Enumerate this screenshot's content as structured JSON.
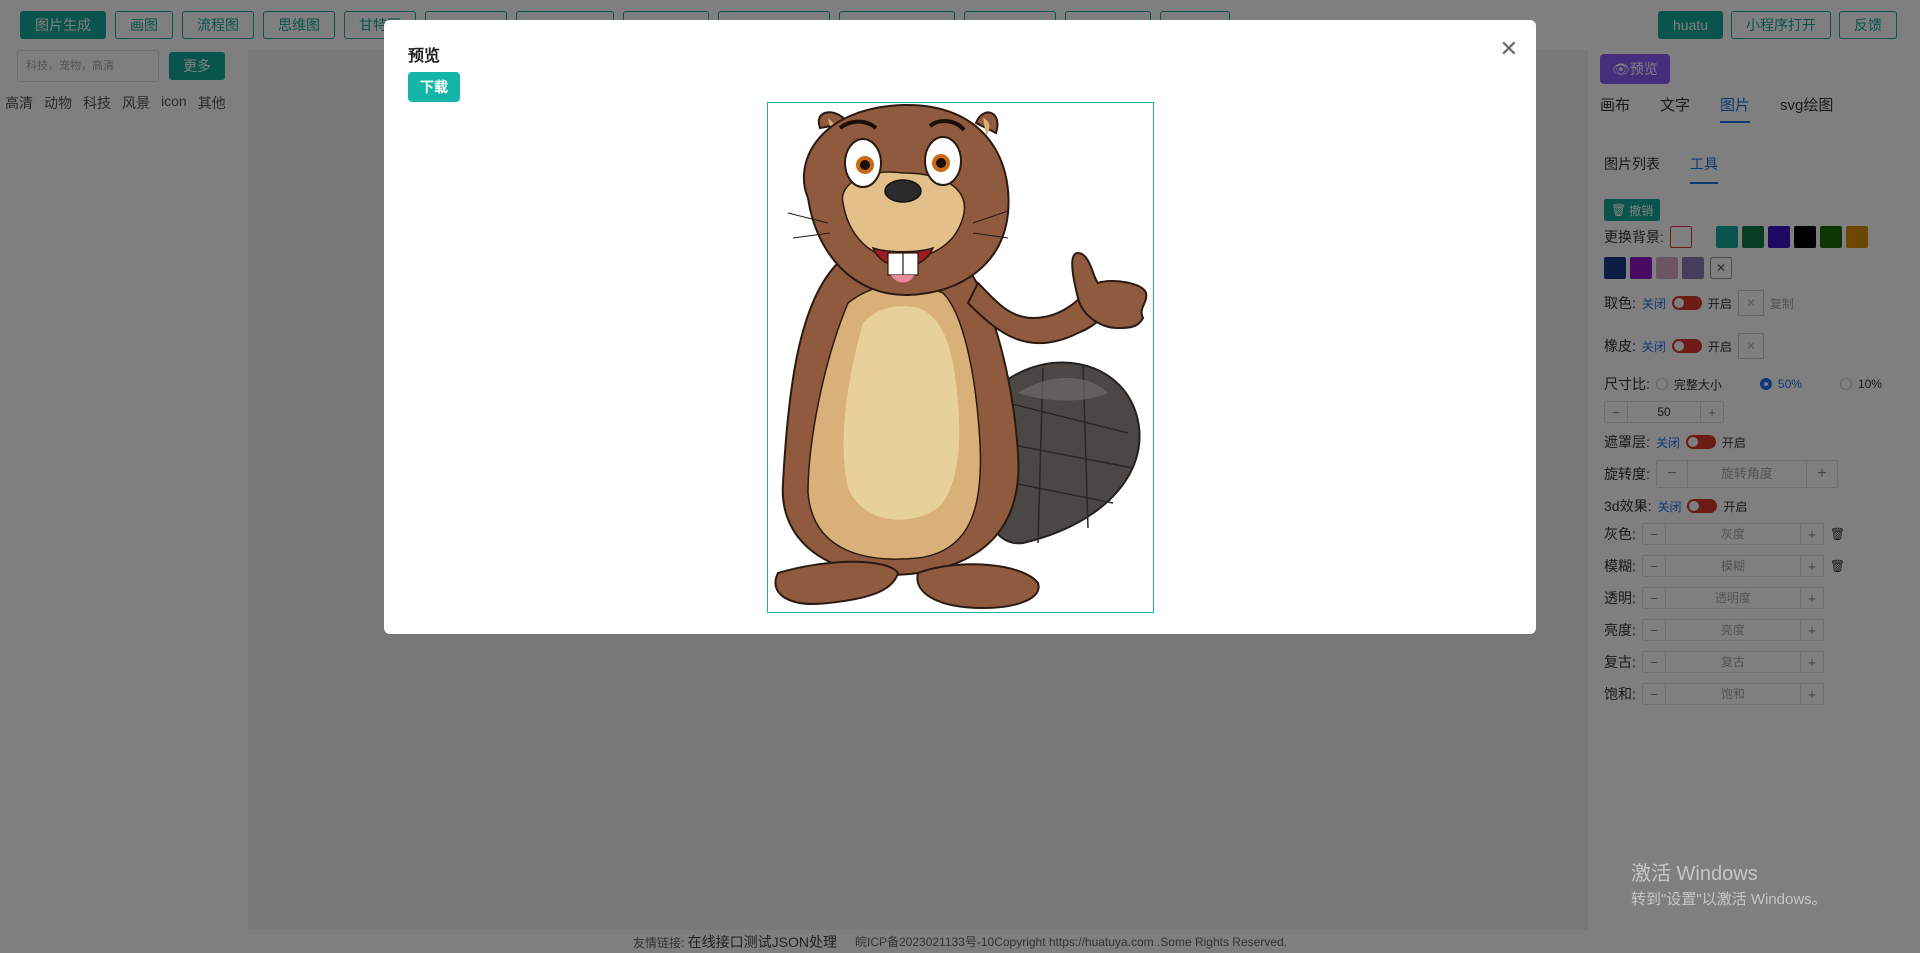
{
  "topbar": {
    "left_buttons": [
      "图片生成",
      "画图",
      "流程图",
      "思维图",
      "甘特图",
      "",
      "",
      "",
      "",
      "",
      "",
      "",
      ""
    ],
    "right_buttons": [
      "huatu",
      "小程序打开",
      "反馈"
    ]
  },
  "left": {
    "search_placeholder": "科技，宠物，高清",
    "more_label": "更多",
    "categories": [
      "高清",
      "动物",
      "科技",
      "风景",
      "icon",
      "其他"
    ]
  },
  "footer": {
    "friend_label": "友情链接:",
    "friend_links": "在线接口测试JSON处理",
    "copyright": "皖ICP备2023021133号-10Copyright https://huatuya.com .Some Rights Reserved."
  },
  "right": {
    "preview_label": "👁预览",
    "tabs": [
      "画布",
      "文字",
      "图片",
      "svg绘图"
    ],
    "active_tab": "图片",
    "subtabs": [
      "图片列表",
      "工具"
    ],
    "undo_label": "撤销",
    "bg_label": "更换背景:",
    "bg_colors": [
      "#12a89a",
      "#0b7a4b",
      "#3b12c9",
      "#000000",
      "#1f6a06",
      "#d98e04",
      "#1b3c8a",
      "#8e12c9",
      "#d7a8c8",
      "#8a7ab8"
    ],
    "pick_color_label": "取色:",
    "close_label": "关闭",
    "open_label": "开启",
    "copy_label": "复制",
    "eraser_label": "橡皮:",
    "ratio_label": "尺寸比:",
    "ratio_options": [
      "完整大小",
      "50%",
      "10%"
    ],
    "ratio_selected": "50%",
    "ratio_value": "50",
    "mask_label": "遮罩层:",
    "rotate_label": "旋转度:",
    "rotate_placeholder": "旋转角度",
    "effect3d_label": "3d效果:",
    "adjust": [
      {
        "label": "灰色:",
        "placeholder": "灰度",
        "trash": true
      },
      {
        "label": "模糊:",
        "placeholder": "模糊",
        "trash": true
      },
      {
        "label": "透明:",
        "placeholder": "透明度",
        "trash": false
      },
      {
        "label": "亮度:",
        "placeholder": "亮度",
        "trash": false
      },
      {
        "label": "复古:",
        "placeholder": "复古",
        "trash": false
      },
      {
        "label": "饱和:",
        "placeholder": "饱和",
        "trash": false
      }
    ]
  },
  "modal": {
    "title": "预览",
    "download_label": "下载",
    "image_subject": "cartoon-beaver"
  },
  "watermark": {
    "line1": "激活 Windows",
    "line2": "转到\"设置\"以激活 Windows。"
  }
}
